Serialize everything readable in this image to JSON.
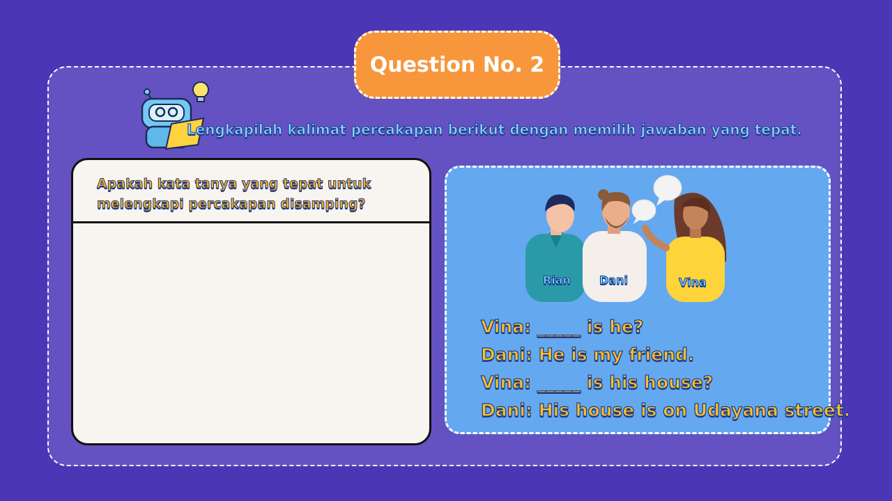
{
  "title": "Question No. 2",
  "instruction": "Lengkapilah kalimat percakapan berikut dengan memilih jawaban yang tepat.",
  "question": {
    "line1": "Apakah kata tanya yang tepat untuk",
    "line2": "melengkapi percakapan disamping?"
  },
  "characters": [
    "Rian",
    "Dani",
    "Vina"
  ],
  "dialog": [
    "Vina: _____ is he?",
    "Dani: He is my friend.",
    "Vina: _____ is his house?",
    "Dani: His house is on Udayana street."
  ],
  "colors": {
    "background": "#4b37b5",
    "title_pill": "#f7963b",
    "dialog_card": "#64a8f0",
    "question_card": "#f8f4ef",
    "dialog_text": "#ffbf27"
  },
  "icons": {
    "robot": "robot-mascot-icon",
    "lightbulb": "lightbulb-icon",
    "speech": "speech-bubble-icon"
  }
}
